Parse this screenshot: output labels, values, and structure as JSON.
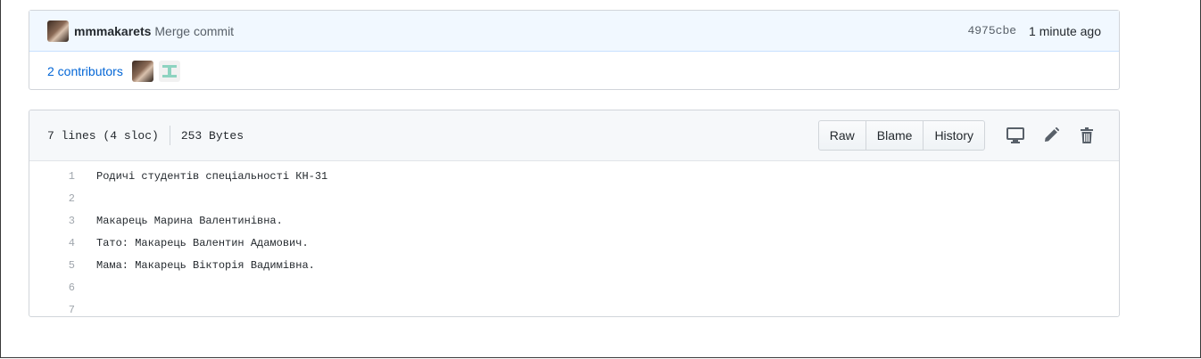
{
  "commit": {
    "author": "mmmakarets",
    "message": "Merge commit",
    "sha": "4975cbe",
    "time": "1 minute ago"
  },
  "contributors": {
    "label": "2 contributors"
  },
  "file": {
    "lines_info": "7 lines (4 sloc)",
    "size": "253 Bytes",
    "buttons": {
      "raw": "Raw",
      "blame": "Blame",
      "history": "History"
    },
    "icons": [
      "desktop-icon",
      "pencil-icon",
      "trash-icon"
    ],
    "code": [
      {
        "num": "1",
        "text": "Родичі студентів спеціальності КН-31"
      },
      {
        "num": "2",
        "text": ""
      },
      {
        "num": "3",
        "text": "Макарець Марина Валентинівна."
      },
      {
        "num": "4",
        "text": "Тато: Макарець Валентин Адамович."
      },
      {
        "num": "5",
        "text": "Мама: Макарець Вікторія Вадимівна."
      },
      {
        "num": "6",
        "text": ""
      },
      {
        "num": "7",
        "text": ""
      }
    ]
  },
  "colors": {
    "link": "#0366d6",
    "commit_bg": "#f1f8ff",
    "header_bg": "#f6f8fa",
    "icon": "#586069"
  }
}
